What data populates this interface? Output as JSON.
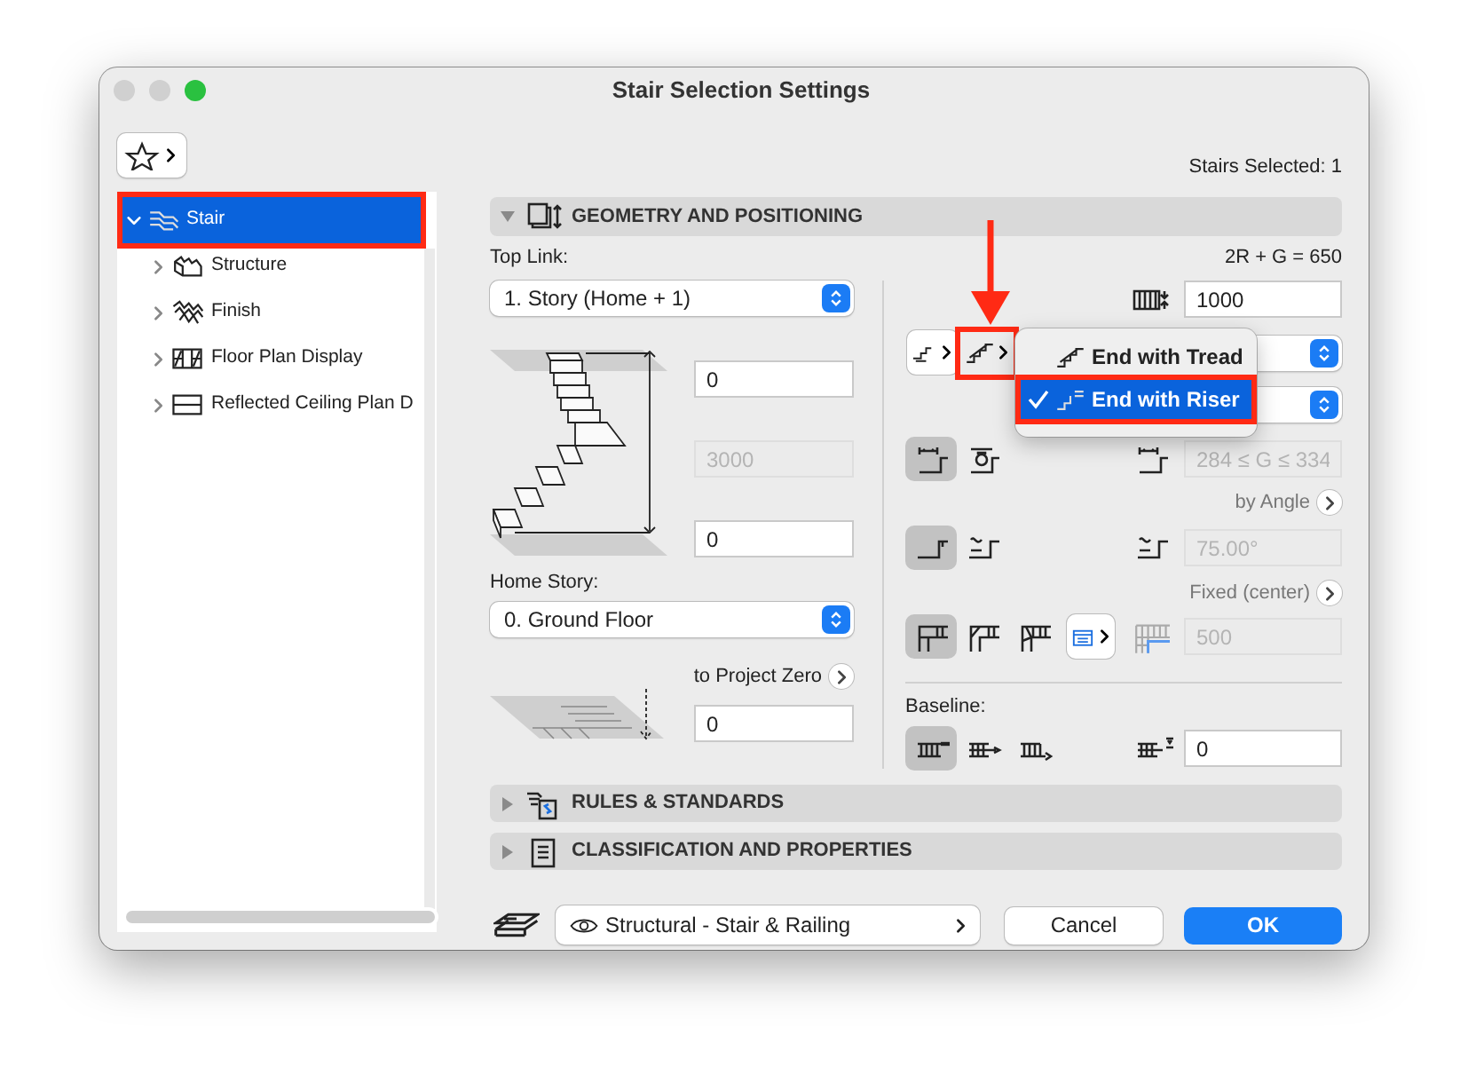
{
  "window": {
    "title": "Stair Selection Settings"
  },
  "selection_count": "Stairs Selected: 1",
  "tree": [
    {
      "label": "Stair",
      "kind": "stair",
      "expanded": true,
      "selected": true,
      "children": [
        {
          "label": "Structure",
          "kind": "structure",
          "expanded": false,
          "selected": false
        },
        {
          "label": "Finish",
          "kind": "finish",
          "expanded": false,
          "selected": false
        },
        {
          "label": "Floor Plan Display",
          "kind": "floor-plan",
          "expanded": false,
          "selected": false
        },
        {
          "label": "Reflected Ceiling Plan D",
          "kind": "ceiling-plan",
          "expanded": false,
          "selected": false
        }
      ]
    }
  ],
  "geometry": {
    "title": "GEOMETRY AND POSITIONING",
    "expanded": true,
    "top_link_label": "Top Link:",
    "top_link": "1. Story (Home + 1)",
    "top_offset": {
      "value": "0",
      "disabled": false
    },
    "height": {
      "value": "3000",
      "disabled": true
    },
    "bottom_offset": {
      "value": "0",
      "disabled": false
    },
    "home_story_label": "Home Story:",
    "home_story": "0. Ground Floor",
    "reference_label": "to Project Zero",
    "reference_offset": {
      "value": "0",
      "disabled": false
    },
    "rule": "2R + G = 650",
    "width": {
      "value": "1000",
      "disabled": false
    },
    "going_modes": [
      {
        "selected": true
      },
      {
        "selected": false
      }
    ],
    "going": {
      "value": "284 ≤ G ≤ 334",
      "disabled": true
    },
    "angle_label": "by Angle",
    "angle_modes": [
      {
        "selected": true
      },
      {
        "selected": false
      }
    ],
    "angle": {
      "value": "75.00°",
      "disabled": true
    },
    "walkline_label": "Fixed (center)",
    "turn_modes": [
      {
        "selected": true
      },
      {
        "selected": false
      },
      {
        "selected": false
      }
    ],
    "walkline": {
      "value": "500",
      "disabled": true
    },
    "baseline_label": "Baseline:",
    "baseline_modes": [
      {
        "selected": true
      },
      {
        "selected": false
      },
      {
        "selected": false
      }
    ],
    "baseline_offset": {
      "value": "0",
      "disabled": false
    }
  },
  "end_menu": [
    {
      "label": "End with Tread",
      "checked": false,
      "selected": false
    },
    {
      "label": "End with Riser",
      "checked": true,
      "selected": true
    }
  ],
  "sections": [
    {
      "title": "RULES & STANDARDS",
      "kind": "rules",
      "expanded": false
    },
    {
      "title": "CLASSIFICATION AND PROPERTIES",
      "kind": "classification",
      "expanded": false
    }
  ],
  "footer": {
    "layer_combination": "Structural - Stair & Railing",
    "buttons": [
      {
        "label": "Cancel",
        "kind": "secondary"
      },
      {
        "label": "OK",
        "kind": "primary"
      }
    ]
  }
}
